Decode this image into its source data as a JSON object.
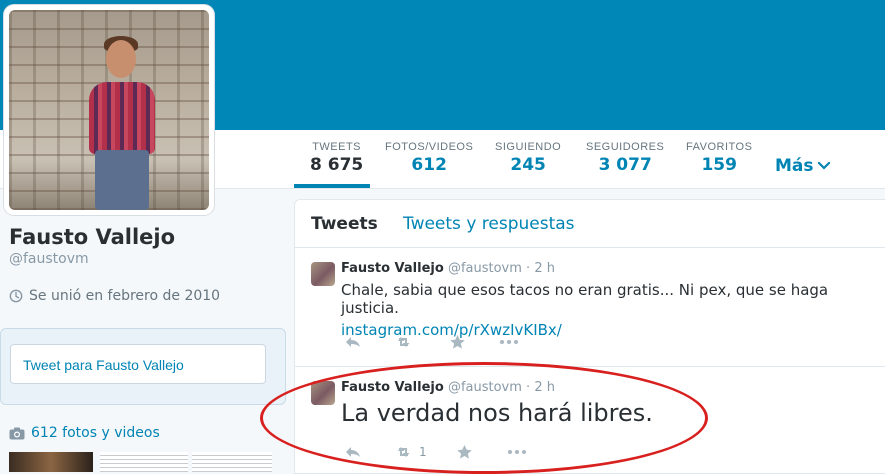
{
  "profile": {
    "name": "Fausto Vallejo",
    "handle": "@faustovm",
    "joined": "Se unió en febrero de 2010",
    "tweet_to_placeholder": "Tweet para Fausto Vallejo",
    "photos_label": "612 fotos y videos"
  },
  "stats": [
    {
      "label": "TWEETS",
      "value": "8 675"
    },
    {
      "label": "FOTOS/VIDEOS",
      "value": "612"
    },
    {
      "label": "SIGUIENDO",
      "value": "245"
    },
    {
      "label": "SEGUIDORES",
      "value": "3 077"
    },
    {
      "label": "FAVORITOS",
      "value": "159"
    }
  ],
  "more_label": "Más",
  "tabs": {
    "active": "Tweets",
    "other": "Tweets y respuestas"
  },
  "tweets": [
    {
      "name": "Fausto Vallejo",
      "handle": "@faustovm",
      "sep": "·",
      "time": "2 h",
      "text": "Chale, sabia que esos tacos no eran gratis... Ni pex, que se haga justicia.",
      "link": "instagram.com/p/rXwzIvKIBx/"
    },
    {
      "name": "Fausto Vallejo",
      "handle": "@faustovm",
      "sep": "·",
      "time": "2 h",
      "text": "La verdad nos hará libres.",
      "retweets": "1"
    }
  ],
  "colors": {
    "banner": "#0087b8",
    "link": "#0084b4",
    "annotation": "#d8201f"
  },
  "icons": [
    "clock-icon",
    "camera-icon",
    "reply-icon",
    "retweet-icon",
    "favorite-icon",
    "more-icon",
    "chevron-down-icon"
  ]
}
